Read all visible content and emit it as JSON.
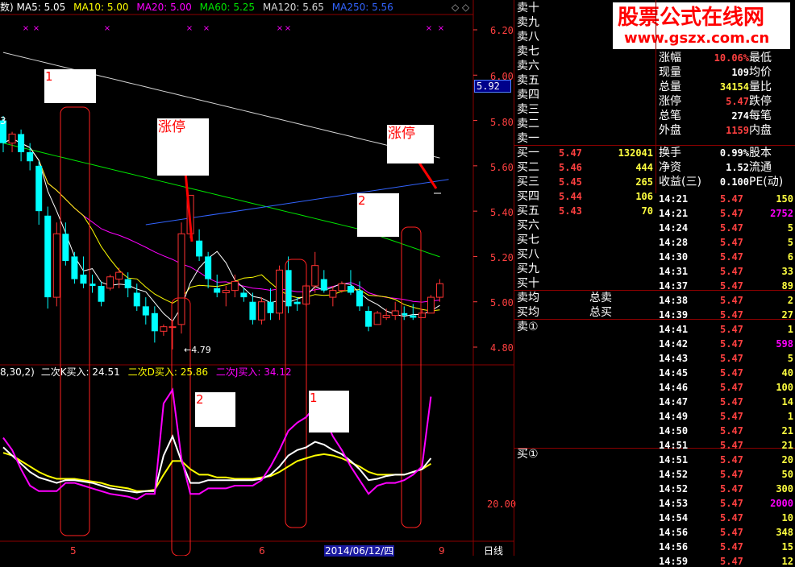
{
  "colors": {
    "up": "#ff3232",
    "down": "#00ffff",
    "ma5": "#ffffff",
    "ma10": "#ffff00",
    "ma20": "#ff00ff",
    "ma60": "#00e600",
    "ma120": "#d8d8d8",
    "ma250": "#3264ff",
    "grid": "#8b0000",
    "label_red": "#ff0000",
    "vol": "#ffff40"
  },
  "header": {
    "ma5": "MA5: 5.05",
    "ma10": "MA10: 5.00",
    "ma20": "MA20: 5.00",
    "ma60": "MA60: 5.25",
    "ma120": "MA120: 5.65",
    "ma250": "MA250: 5.56",
    "prefix": "数)",
    "diamonds": "◇ ◇"
  },
  "price_axis": [
    "6.20",
    "6.00",
    "5.80",
    "5.60",
    "5.40",
    "5.20",
    "5.00",
    "4.80"
  ],
  "price_marker": "5.92",
  "low_label": "←4.79",
  "left_three": "3",
  "indicator": {
    "prefix": "8,30,2)",
    "k": "二次K买入: 24.51",
    "d": "二次D买入: 25.86",
    "j": "二次J买入: 34.12",
    "axis": "20.00"
  },
  "x_axis": {
    "labels": [
      "5",
      "6",
      "9"
    ],
    "date": "2014/06/12/四",
    "period": "日线"
  },
  "annotations": {
    "n1": "1",
    "zt1": "涨停",
    "zt2": "涨停",
    "n2": "2",
    "n2b": "2",
    "n1b": "1"
  },
  "chart_data": {
    "type": "candlestick",
    "ylim": [
      4.72,
      6.28
    ],
    "ohlc": [
      [
        5.8,
        5.82,
        5.66,
        5.7
      ],
      [
        5.7,
        5.75,
        5.66,
        5.74
      ],
      [
        5.74,
        5.76,
        5.62,
        5.66
      ],
      [
        5.66,
        5.7,
        5.58,
        5.62
      ],
      [
        5.6,
        5.62,
        5.34,
        5.4
      ],
      [
        5.38,
        5.42,
        4.97,
        5.02
      ],
      [
        5.02,
        5.35,
        4.98,
        5.3
      ],
      [
        5.3,
        5.35,
        5.16,
        5.18
      ],
      [
        5.2,
        5.22,
        5.08,
        5.1
      ],
      [
        5.12,
        5.2,
        5.06,
        5.08
      ],
      [
        5.08,
        5.12,
        5.04,
        5.07
      ],
      [
        5.07,
        5.09,
        4.98,
        5.0
      ],
      [
        5.06,
        5.12,
        5.05,
        5.11
      ],
      [
        5.1,
        5.15,
        5.06,
        5.13
      ],
      [
        5.1,
        5.13,
        5.02,
        5.06
      ],
      [
        5.04,
        5.08,
        4.96,
        4.98
      ],
      [
        4.98,
        5.02,
        4.9,
        4.94
      ],
      [
        4.95,
        4.98,
        4.82,
        4.87
      ],
      [
        4.87,
        4.9,
        4.85,
        4.89
      ],
      [
        4.89,
        4.92,
        4.79,
        4.89
      ],
      [
        4.9,
        5.35,
        4.86,
        5.3
      ],
      [
        5.3,
        5.47,
        5.28,
        5.47
      ],
      [
        5.27,
        5.32,
        5.18,
        5.2
      ],
      [
        5.2,
        5.22,
        5.06,
        5.1
      ],
      [
        5.06,
        5.12,
        5.02,
        5.04
      ],
      [
        5.04,
        5.07,
        4.98,
        5.05
      ],
      [
        5.05,
        5.12,
        5.02,
        5.09
      ],
      [
        5.04,
        5.06,
        5.0,
        5.02
      ],
      [
        5.0,
        5.04,
        4.9,
        4.92
      ],
      [
        4.92,
        5.02,
        4.9,
        5.0
      ],
      [
        5.0,
        5.06,
        4.92,
        4.95
      ],
      [
        4.95,
        5.16,
        4.92,
        5.14
      ],
      [
        5.14,
        5.2,
        4.95,
        4.98
      ],
      [
        5.0,
        5.02,
        4.96,
        4.99
      ],
      [
        4.99,
        5.08,
        4.98,
        5.07
      ],
      [
        5.07,
        5.22,
        5.04,
        5.16
      ],
      [
        5.1,
        5.14,
        5.04,
        5.05
      ],
      [
        5.02,
        5.07,
        4.98,
        5.05
      ],
      [
        5.05,
        5.09,
        5.04,
        5.08
      ],
      [
        5.07,
        5.14,
        5.03,
        5.04
      ],
      [
        5.05,
        5.09,
        4.96,
        4.98
      ],
      [
        4.96,
        4.98,
        4.87,
        4.89
      ],
      [
        4.9,
        4.96,
        4.9,
        4.95
      ],
      [
        4.93,
        4.97,
        4.92,
        4.94
      ],
      [
        4.94,
        5.0,
        4.92,
        4.96
      ],
      [
        4.95,
        4.98,
        4.92,
        4.94
      ],
      [
        4.94,
        4.99,
        4.92,
        4.93
      ],
      [
        4.93,
        4.97,
        4.93,
        4.95
      ],
      [
        4.95,
        5.03,
        4.95,
        5.02
      ],
      [
        5.02,
        5.1,
        5.0,
        5.08
      ]
    ],
    "ma250": {
      "x": [
        16,
        50
      ],
      "y": [
        5.34,
        5.54
      ]
    },
    "k": [
      38,
      32,
      26,
      20,
      16,
      14,
      12,
      14,
      14,
      13,
      12,
      10,
      8,
      7,
      6,
      5,
      6,
      6,
      32,
      46,
      28,
      12,
      12,
      14,
      14,
      14,
      14,
      14,
      14,
      15,
      18,
      24,
      32,
      36,
      38,
      42,
      40,
      36,
      33,
      28,
      22,
      14,
      15,
      17,
      18,
      18,
      20,
      22,
      30
    ],
    "d": [
      34,
      32,
      28,
      24,
      20,
      17,
      15,
      15,
      15,
      14,
      13,
      12,
      10,
      9,
      8,
      6,
      6,
      7,
      18,
      28,
      28,
      22,
      18,
      18,
      16,
      16,
      15,
      15,
      15,
      16,
      17,
      20,
      24,
      28,
      30,
      32,
      33,
      32,
      30,
      27,
      24,
      20,
      18,
      18,
      18,
      18,
      20,
      22,
      26
    ],
    "j": [
      45,
      36,
      22,
      10,
      6,
      6,
      6,
      12,
      12,
      10,
      8,
      6,
      4,
      3,
      2,
      0,
      4,
      4,
      70,
      80,
      30,
      4,
      4,
      8,
      8,
      8,
      10,
      10,
      10,
      14,
      24,
      36,
      50,
      56,
      60,
      68,
      60,
      46,
      36,
      24,
      14,
      4,
      10,
      12,
      12,
      14,
      18,
      24,
      75
    ],
    "boxes": [
      [
        6,
        2
      ],
      [
        20,
        3
      ],
      [
        34,
        1
      ],
      [
        47,
        1
      ]
    ]
  },
  "watermark": {
    "title": "股票公式在线网",
    "url": "www.gszx.com.cn"
  },
  "orderbook": {
    "sells": [
      "卖十",
      "卖九",
      "卖八",
      "卖七",
      "卖六",
      "卖五",
      "卖四",
      "卖三",
      "卖二",
      "卖一"
    ],
    "buys": [
      {
        "label": "买一",
        "price": "5.47",
        "vol": "132041"
      },
      {
        "label": "买二",
        "price": "5.46",
        "vol": "444"
      },
      {
        "label": "买三",
        "price": "5.45",
        "vol": "265"
      },
      {
        "label": "买四",
        "price": "5.44",
        "vol": "106"
      },
      {
        "label": "买五",
        "price": "5.43",
        "vol": "70"
      },
      {
        "label": "买六",
        "price": "",
        "vol": ""
      },
      {
        "label": "买七",
        "price": "",
        "vol": ""
      },
      {
        "label": "买八",
        "price": "",
        "vol": ""
      },
      {
        "label": "买九",
        "price": "",
        "vol": ""
      },
      {
        "label": "买十",
        "price": "",
        "vol": ""
      }
    ],
    "avg_sell": "卖均",
    "avg_buy": "买均",
    "total_sell": "总卖",
    "total_buy": "总买",
    "sell1": "卖①",
    "buy1": "买①"
  },
  "stats": [
    {
      "l": "",
      "v": "",
      "r": ""
    },
    {
      "l": "涨幅",
      "v": "10.06%",
      "r": "最低"
    },
    {
      "l": "现量",
      "v": "109",
      "r": "均价"
    },
    {
      "l": "总量",
      "v": "34154",
      "r": "量比"
    },
    {
      "l": "涨停",
      "v": "5.47",
      "r": "跌停"
    },
    {
      "l": "总笔",
      "v": "274",
      "r": "每笔"
    },
    {
      "l": "外盘",
      "v": "1159",
      "r": "内盘"
    }
  ],
  "stats2": [
    {
      "l": "换手",
      "v": "0.99%",
      "r": "股本"
    },
    {
      "l": "净资",
      "v": "1.52",
      "r": "流通"
    },
    {
      "l": "收益(三)",
      "v": "0.100",
      "r": "PE(动)"
    }
  ],
  "ticks": [
    {
      "t": "14:21",
      "p": "5.47",
      "v": "150"
    },
    {
      "t": "14:21",
      "p": "5.47",
      "v": "2752"
    },
    {
      "t": "14:24",
      "p": "5.47",
      "v": "5"
    },
    {
      "t": "14:28",
      "p": "5.47",
      "v": "5"
    },
    {
      "t": "14:30",
      "p": "5.47",
      "v": "6"
    },
    {
      "t": "14:31",
      "p": "5.47",
      "v": "33"
    },
    {
      "t": "14:37",
      "p": "5.47",
      "v": "89"
    },
    {
      "t": "14:38",
      "p": "5.47",
      "v": "2"
    },
    {
      "t": "14:39",
      "p": "5.47",
      "v": "27"
    },
    {
      "t": "14:41",
      "p": "5.47",
      "v": "1"
    },
    {
      "t": "14:42",
      "p": "5.47",
      "v": "598"
    },
    {
      "t": "14:43",
      "p": "5.47",
      "v": "5"
    },
    {
      "t": "14:45",
      "p": "5.47",
      "v": "40"
    },
    {
      "t": "14:46",
      "p": "5.47",
      "v": "100"
    },
    {
      "t": "14:47",
      "p": "5.47",
      "v": "14"
    },
    {
      "t": "14:49",
      "p": "5.47",
      "v": "1"
    },
    {
      "t": "14:50",
      "p": "5.47",
      "v": "21"
    },
    {
      "t": "14:51",
      "p": "5.47",
      "v": "21"
    },
    {
      "t": "14:51",
      "p": "5.47",
      "v": "20"
    },
    {
      "t": "14:52",
      "p": "5.47",
      "v": "50"
    },
    {
      "t": "14:52",
      "p": "5.47",
      "v": "300"
    },
    {
      "t": "14:53",
      "p": "5.47",
      "v": "2000"
    },
    {
      "t": "14:54",
      "p": "5.47",
      "v": "10"
    },
    {
      "t": "14:56",
      "p": "5.47",
      "v": "348"
    },
    {
      "t": "14:56",
      "p": "5.47",
      "v": "15"
    },
    {
      "t": "14:59",
      "p": "5.47",
      "v": "12"
    }
  ],
  "tick_vol_colors": [
    "#ffff40",
    "#ff00ff",
    "#ffff40",
    "#ffff40",
    "#ffff40",
    "#ffff40",
    "#ffff40",
    "#ffff40",
    "#ffff40",
    "#ffff40",
    "#ff00ff",
    "#ffff40",
    "#ffff40",
    "#ffff40",
    "#ffff40",
    "#ffff40",
    "#ffff40",
    "#ffff40",
    "#ffff40",
    "#ffff40",
    "#ffff40",
    "#ff00ff",
    "#ffff40",
    "#ffff40",
    "#ffff40",
    "#ffff40"
  ]
}
